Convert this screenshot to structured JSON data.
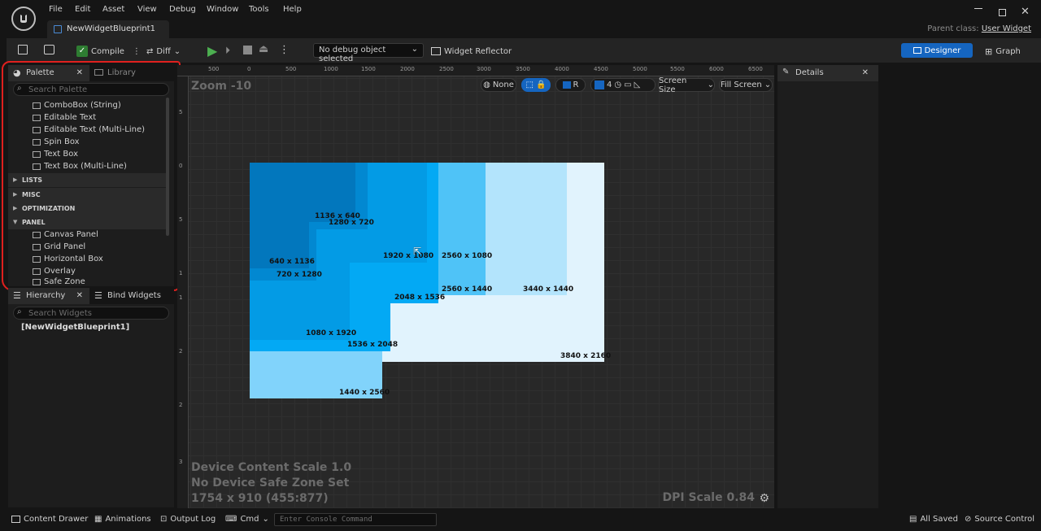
{
  "menu": [
    "File",
    "Edit",
    "Asset",
    "View",
    "Debug",
    "Window",
    "Tools",
    "Help"
  ],
  "document_tab": "NewWidgetBlueprint1",
  "parent_class": {
    "label": "Parent class:",
    "value": "User Widget"
  },
  "toolbar": {
    "compile": "Compile",
    "diff": "Diff",
    "debug_select": "No debug object selected",
    "widget_reflector": "Widget Reflector",
    "designer": "Designer",
    "graph": "Graph"
  },
  "palette": {
    "tab_palette": "Palette",
    "tab_library": "Library",
    "search_placeholder": "Search Palette",
    "items_top": [
      "ComboBox (String)",
      "Editable Text",
      "Editable Text (Multi-Line)",
      "Spin Box",
      "Text Box",
      "Text Box (Multi-Line)"
    ],
    "categories": [
      "LISTS",
      "MISC",
      "OPTIMIZATION",
      "PANEL"
    ],
    "panel_items": [
      "Canvas Panel",
      "Grid Panel",
      "Horizontal Box",
      "Overlay",
      "Safe Zone"
    ]
  },
  "hierarchy": {
    "tab_hierarchy": "Hierarchy",
    "tab_bind": "Bind Widgets",
    "search_placeholder": "Search Widgets",
    "root": "[NewWidgetBlueprint1]"
  },
  "viewport": {
    "zoom": "Zoom -10",
    "none": "None",
    "r": "R",
    "grid_num": "4",
    "screen_size": "Screen Size",
    "fill_screen": "Fill Screen",
    "ruler_top": [
      "500",
      "0",
      "500",
      "1000",
      "1500",
      "2000",
      "2500",
      "3000",
      "3500",
      "4000",
      "4500",
      "5000",
      "5500",
      "6000",
      "6500"
    ],
    "ruler_left": [
      "5",
      "0",
      "5",
      "1",
      "1",
      "2",
      "2",
      "3"
    ],
    "device_scale": "Device Content Scale 1.0",
    "safe_zone": "No Device Safe Zone Set",
    "resolution": "1754 x 910 (455:877)",
    "dpi_scale": "DPI Scale 0.84",
    "resolutions": [
      {
        "label": "3840 x 2160",
        "color": "#e1f3fd"
      },
      {
        "label": "1440 x 2560",
        "color": "#81d3fb"
      },
      {
        "label": "3440 x 1440",
        "color": "#b3e4fc"
      },
      {
        "label": "2560 x 1440",
        "color": "#4fc3f7"
      },
      {
        "label": "2560 x 1080",
        "color": "#4fc3f7"
      },
      {
        "label": "1536 x 2048",
        "color": "#03a9f4"
      },
      {
        "label": "2048 x 1536",
        "color": "#03a9f4"
      },
      {
        "label": "1080 x 1920",
        "color": "#039be5"
      },
      {
        "label": "1920 x 1080",
        "color": "#039be5"
      },
      {
        "label": "720 x 1280",
        "color": "#0288d1"
      },
      {
        "label": "1280 x 720",
        "color": "#0288d1"
      },
      {
        "label": "640 x 1136",
        "color": "#0277bd"
      },
      {
        "label": "1136 x 640",
        "color": "#0277bd"
      }
    ]
  },
  "details": {
    "tab": "Details"
  },
  "bottom": {
    "content_drawer": "Content Drawer",
    "animations": "Animations",
    "output_log": "Output Log",
    "cmd": "Cmd",
    "console_placeholder": "Enter Console Command",
    "all_saved": "All Saved",
    "source_control": "Source Control"
  }
}
